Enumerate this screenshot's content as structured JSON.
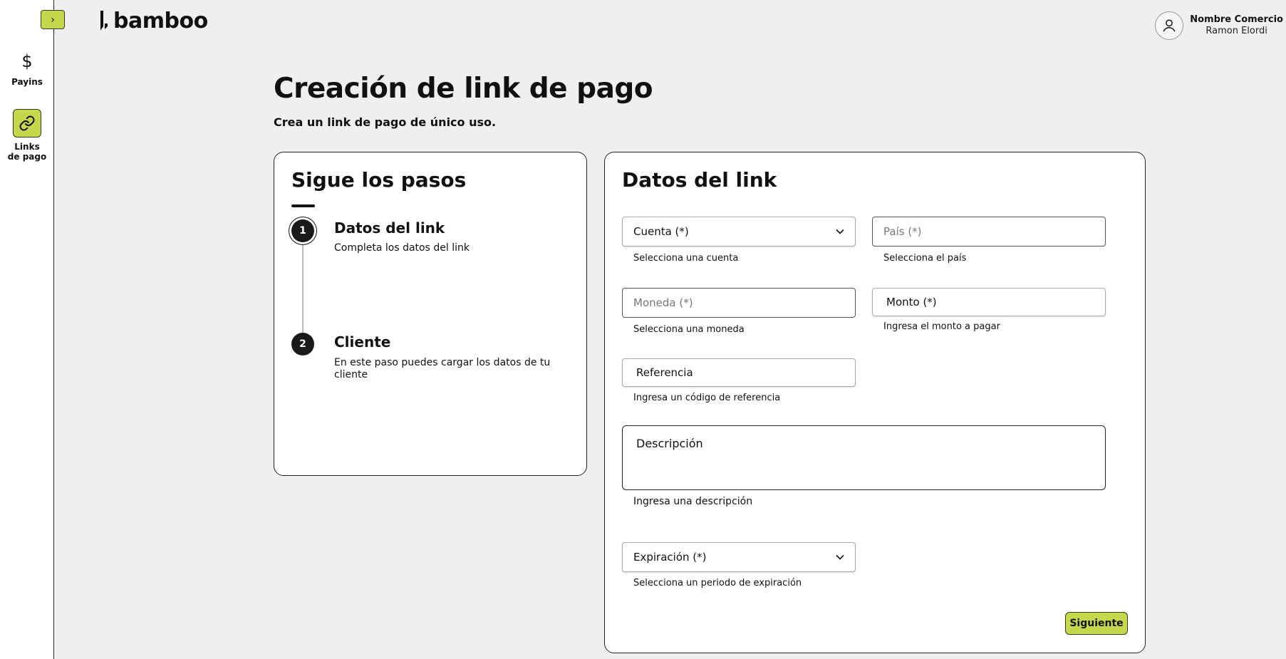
{
  "sidebar": {
    "toggle_icon": "chevron-right-icon",
    "toggle_glyph": "›",
    "items": [
      {
        "label": "Payins",
        "icon": "dollar-icon",
        "glyph": "$"
      },
      {
        "label": "Links de pago",
        "icon": "link-icon"
      }
    ]
  },
  "header": {
    "logo_text": "bamboo",
    "user_name": "Nombre Comercio",
    "user_sub": "Ramon Elordi"
  },
  "page": {
    "title": "Creación de link de pago",
    "subtitle": "Crea un link de pago de único uso."
  },
  "steps": {
    "title": "Sigue los pasos",
    "items": [
      {
        "number": "1",
        "title": "Datos del link",
        "desc": "Completa los datos del link"
      },
      {
        "number": "2",
        "title": "Cliente",
        "desc": "En este paso puedes cargar los datos de tu cliente"
      }
    ]
  },
  "form": {
    "title": "Datos del link",
    "cuenta": {
      "label": "Cuenta (*)",
      "helper": "Selecciona una cuenta"
    },
    "pais": {
      "placeholder": "País (*)",
      "helper": "Selecciona el país"
    },
    "moneda": {
      "placeholder": "Moneda (*)",
      "helper": "Selecciona una moneda"
    },
    "monto": {
      "label": "Monto (*)",
      "helper": "Ingresa el monto a pagar"
    },
    "referencia": {
      "label": "Referencia",
      "helper": "Ingresa un código de referencia"
    },
    "descripcion": {
      "label": "Descripción",
      "helper": "Ingresa una descripción"
    },
    "expiracion": {
      "label": "Expiración (*)",
      "helper": "Selecciona un periodo de expiración"
    },
    "next_label": "Siguiente"
  },
  "colors": {
    "accent": "#c5d84b",
    "background": "#f0eff0",
    "text": "#111111"
  }
}
